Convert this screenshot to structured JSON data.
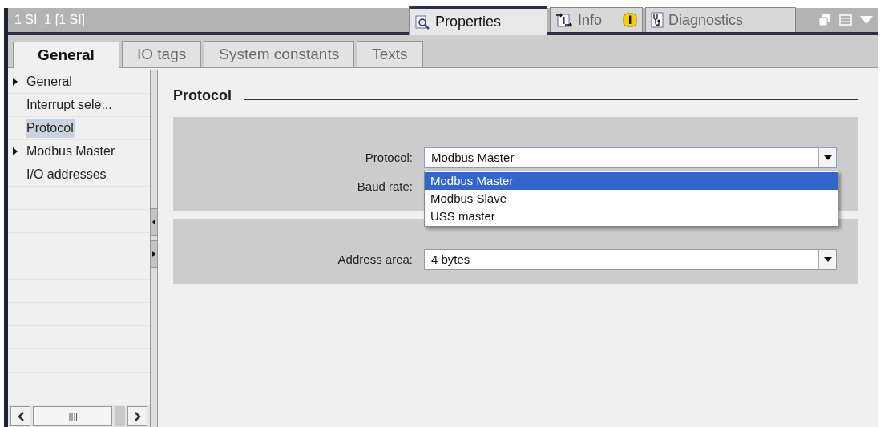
{
  "window": {
    "title": "1 SI_1 [1 SI]"
  },
  "inspector_tabs": [
    {
      "label": "Properties",
      "kind": "properties",
      "selected": true,
      "badge": false
    },
    {
      "label": "Info",
      "kind": "info",
      "selected": false,
      "badge": true
    },
    {
      "label": "Diagnostics",
      "kind": "diagnostics",
      "selected": false,
      "badge": false
    }
  ],
  "tabs": [
    {
      "label": "General",
      "selected": true
    },
    {
      "label": "IO tags",
      "selected": false
    },
    {
      "label": "System constants",
      "selected": false
    },
    {
      "label": "Texts",
      "selected": false
    }
  ],
  "sidebar": {
    "items": [
      {
        "label": "General",
        "expandable": true,
        "selected": false
      },
      {
        "label": "Interrupt sele...",
        "expandable": false,
        "selected": false
      },
      {
        "label": "Protocol",
        "expandable": false,
        "selected": true
      },
      {
        "label": "Modbus Master",
        "expandable": true,
        "selected": false
      },
      {
        "label": "I/O addresses",
        "expandable": false,
        "selected": false
      }
    ]
  },
  "section": {
    "title": "Protocol"
  },
  "groups": [
    {
      "fields": [
        {
          "label": "Protocol:",
          "kind": "dropdown",
          "value": "Modbus Master",
          "expanded": true,
          "options": [
            {
              "label": "Modbus Master",
              "selected": true
            },
            {
              "label": "Modbus Slave",
              "selected": false
            },
            {
              "label": "USS master",
              "selected": false
            }
          ]
        },
        {
          "label": "Baud rate:",
          "kind": "hidden"
        }
      ]
    },
    {
      "fields": [
        {
          "label": "Address area:",
          "kind": "dropdown",
          "value": "4 bytes",
          "expanded": false
        }
      ]
    }
  ]
}
